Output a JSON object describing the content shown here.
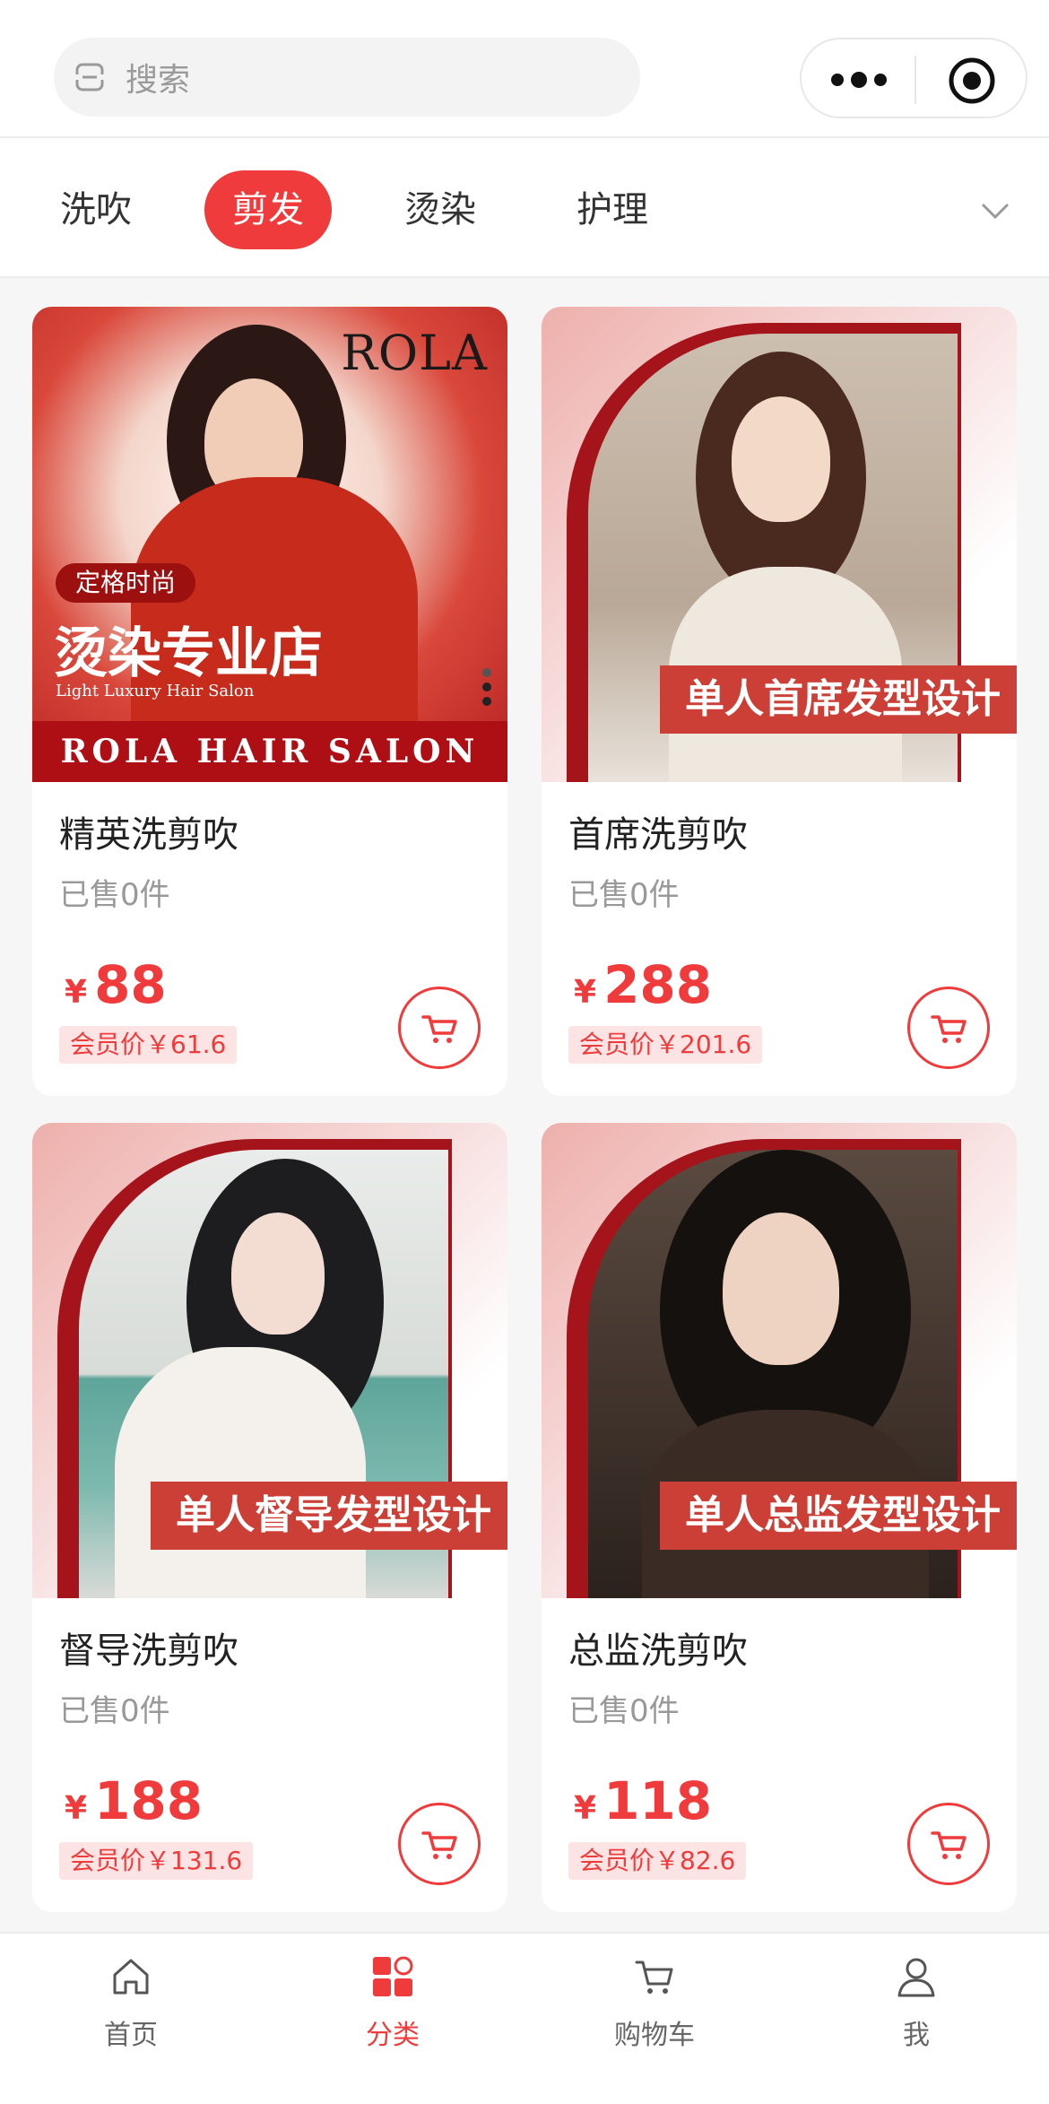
{
  "search": {
    "placeholder": "搜索"
  },
  "tabs": [
    {
      "label": "洗吹",
      "active": false
    },
    {
      "label": "剪发",
      "active": true
    },
    {
      "label": "烫染",
      "active": false
    },
    {
      "label": "护理",
      "active": false
    }
  ],
  "colors": {
    "accent": "#ef3b3b",
    "member_bg": "#fde4e4",
    "banner_red": "#ad0f15"
  },
  "products": [
    {
      "name": "精英洗剪吹",
      "sold": "已售0件",
      "currency": "¥",
      "price": "88",
      "member_price": "会员价￥61.6",
      "poster": {
        "brand": "ROLA",
        "tag": "定格时尚",
        "title": "烫染专业店",
        "subtitle": "Light Luxury Hair Salon",
        "band": "ROLA HAIR SALON"
      }
    },
    {
      "name": "首席洗剪吹",
      "sold": "已售0件",
      "currency": "¥",
      "price": "288",
      "member_price": "会员价￥201.6",
      "poster": {
        "ribbon": "单人首席发型设计"
      }
    },
    {
      "name": "督导洗剪吹",
      "sold": "已售0件",
      "currency": "¥",
      "price": "188",
      "member_price": "会员价￥131.6",
      "poster": {
        "ribbon": "单人督导发型设计"
      }
    },
    {
      "name": "总监洗剪吹",
      "sold": "已售0件",
      "currency": "¥",
      "price": "118",
      "member_price": "会员价￥82.6",
      "poster": {
        "ribbon": "单人总监发型设计"
      }
    }
  ],
  "bottom_nav": [
    {
      "label": "首页",
      "icon": "home-icon",
      "active": false
    },
    {
      "label": "分类",
      "icon": "category-icon",
      "active": true
    },
    {
      "label": "购物车",
      "icon": "cart-icon",
      "active": false
    },
    {
      "label": "我",
      "icon": "user-icon",
      "active": false
    }
  ]
}
